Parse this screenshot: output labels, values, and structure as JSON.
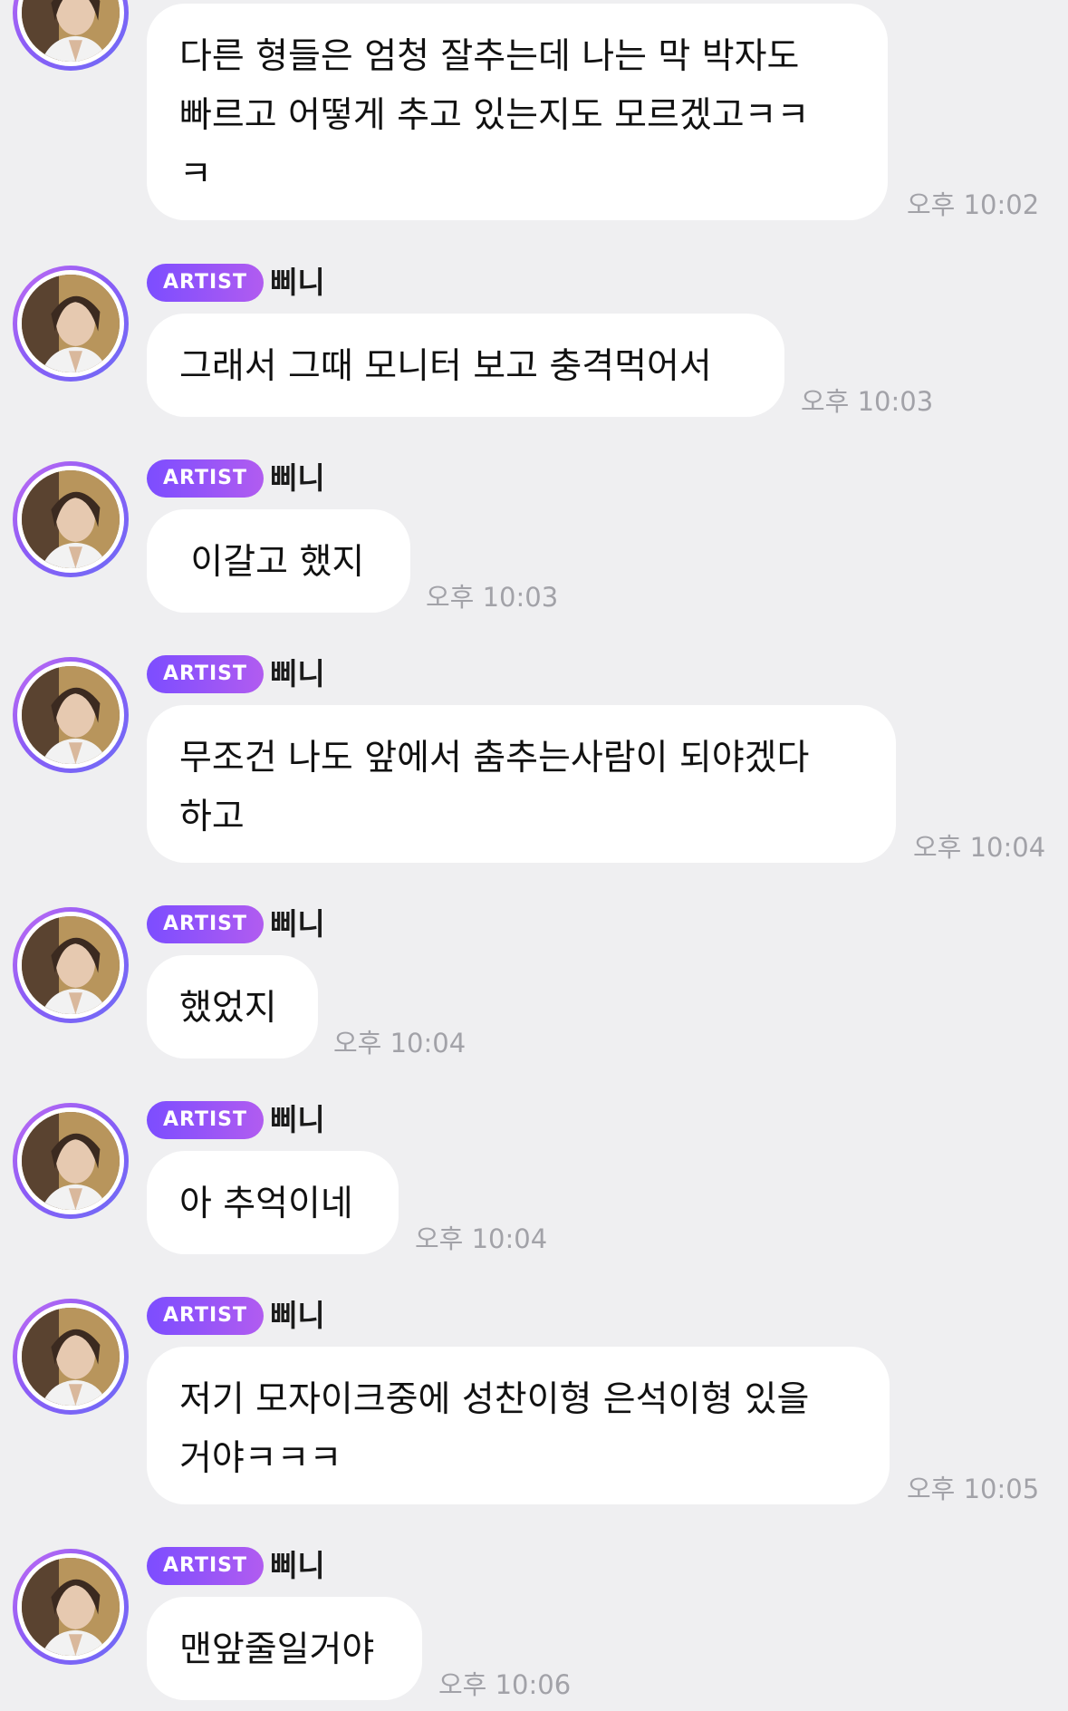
{
  "sender": {
    "badge": "ARTIST",
    "name": "삐니"
  },
  "messages": [
    {
      "text": "다른 형들은 엄청 잘추는데 나는 막 박자도\n빠르고 어떻게 추고 있는지도 모르겠고ㅋㅋ\nㅋ",
      "time": "오후 10:02"
    },
    {
      "text": "그래서 그때 모니터 보고 충격먹어서",
      "time": "오후 10:03"
    },
    {
      "text": " 이갈고 했지",
      "time": "오후 10:03"
    },
    {
      "text": "무조건 나도 앞에서 춤추는사람이 되야겠다\n하고",
      "time": "오후 10:04"
    },
    {
      "text": "했었지",
      "time": "오후 10:04"
    },
    {
      "text": "아 추억이네",
      "time": "오후 10:04"
    },
    {
      "text": "저기 모자이크중에 성찬이형 은석이형 있을\n거야ㅋㅋㅋ",
      "time": "오후 10:05"
    },
    {
      "text": "맨앞줄일거야",
      "time": "오후 10:06"
    }
  ],
  "colors": {
    "background": "#efeff1",
    "bubble": "#ffffff",
    "badge_start": "#7c4dff",
    "badge_end": "#b15cf0",
    "time": "#a2a2a8"
  }
}
